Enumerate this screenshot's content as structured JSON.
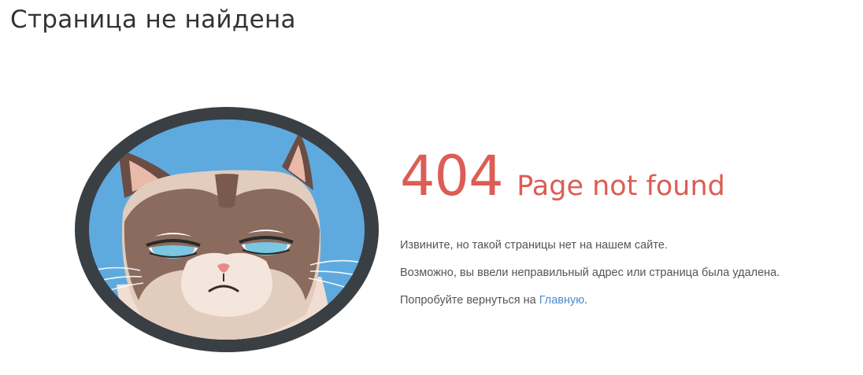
{
  "page": {
    "title": "Страница не найдена"
  },
  "error": {
    "code": "404",
    "title": "Page not found",
    "line1": "Извините, но такой страницы нет на нашем сайте.",
    "line2": "Возможно, вы ввели неправильный адрес или страница была удалена.",
    "line3_prefix": "Попробуйте вернуться на ",
    "home_link": "Главную",
    "line3_suffix": "."
  },
  "illustration": {
    "subject": "grumpy-cat",
    "frame_color": "#3a3f44",
    "background_color": "#5eaadf"
  },
  "colors": {
    "accent": "#dc5d55",
    "link": "#4a8ccd",
    "text": "#555555",
    "title": "#333333"
  }
}
